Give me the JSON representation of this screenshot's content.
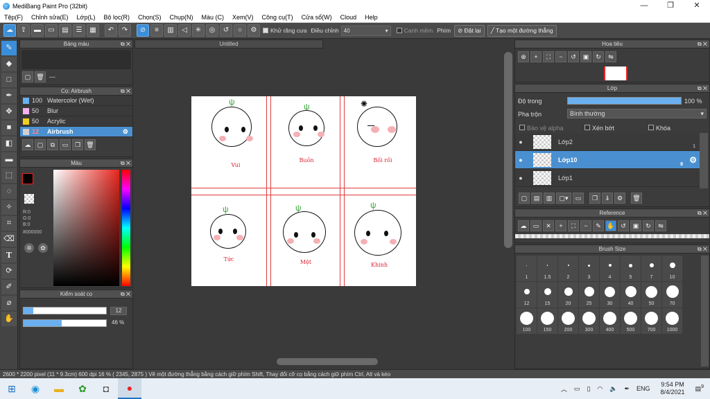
{
  "window": {
    "title": "MediBang Paint Pro (32bit)",
    "minimize": "—",
    "maximize": "❐",
    "close": "✕"
  },
  "menu": [
    "Tệp(F)",
    "Chỉnh sửa(E)",
    "Lớp(L)",
    "Bộ lọc(R)",
    "Chọn(S)",
    "Chụp(N)",
    "Màu (C)",
    "Xem(V)",
    "Công cụ(T)",
    "Cửa sổ(W)",
    "Cloud",
    "Help"
  ],
  "toolbar": {
    "antialias_label": "Khử răng cưa",
    "adjust_label": "Điều chỉnh",
    "adjust_value": "40",
    "snap_label": "Canh mềm",
    "key_label": "Phím",
    "reset_label": "Đặt lại",
    "create_line_label": "Tạo một đường thẳng"
  },
  "palette_panel": {
    "title": "Bảng màu",
    "dashes": "---"
  },
  "brush_panel": {
    "title": "Cọ: Airbrush",
    "items": [
      {
        "size": "100",
        "name": "Watercolor (Wet)",
        "color": "#6ab0f0"
      },
      {
        "size": "50",
        "name": "Blur",
        "color": "#f5b0f0"
      },
      {
        "size": "50",
        "name": "Acrylic",
        "color": "#f0d020"
      },
      {
        "size": "12",
        "name": "Airbrush",
        "color": "#d0d0d0"
      }
    ],
    "selected_index": 3
  },
  "color_panel": {
    "title": "Màu",
    "r": "R:0",
    "g": "G:0",
    "b": "B:0",
    "hex": "#000000"
  },
  "brush_control_panel": {
    "title": "Kiểm soát cọ",
    "size_value": "12",
    "opacity_value": "46 %",
    "size_fraction": 0.12,
    "opacity_fraction": 0.46
  },
  "canvas": {
    "tab_title": "Untitled",
    "labels": [
      "Vui",
      "Buồn",
      "Bối rối",
      "Tức",
      "Mệt",
      "Khinh"
    ]
  },
  "navigator_panel": {
    "title": "Hoa tiêu"
  },
  "layer_panel": {
    "title": "Lớp",
    "opacity_label": "Độ trong",
    "opacity_value": "100 %",
    "opacity_fraction": 1.0,
    "blend_label": "Pha trộn",
    "blend_value": "Bình thường",
    "protect_alpha": "Bảo vệ alpha",
    "clipping": "Xén bớt",
    "lock": "Khóa",
    "layers": [
      {
        "name": "Lớp2",
        "num": "1",
        "selected": false
      },
      {
        "name": "Lớp10",
        "num": "8",
        "selected": true
      },
      {
        "name": "Lớp1",
        "num": "",
        "selected": false
      }
    ]
  },
  "reference_panel": {
    "title": "Reference"
  },
  "brushsize_panel": {
    "title": "Brush Size",
    "sizes": [
      "1",
      "1.5",
      "2",
      "3",
      "4",
      "5",
      "7",
      "10",
      "12",
      "15",
      "20",
      "25",
      "30",
      "40",
      "50",
      "70",
      "100",
      "150",
      "200",
      "300",
      "400",
      "500",
      "700",
      "1000"
    ]
  },
  "status": {
    "text": "2600 * 2200 pixel   (11 * 9.3cm)   600 dpi   16 %   ( 2345, 2875 )   Vẽ một đường thẳng bằng cách giữ phím Shift, Thay đổi cỡ cọ bằng cách giữ phím Ctrl, Alt và kéo"
  },
  "taskbar": {
    "lang": "ENG",
    "time": "9:54 PM",
    "date": "8/4/2021",
    "notif_count": "9"
  }
}
